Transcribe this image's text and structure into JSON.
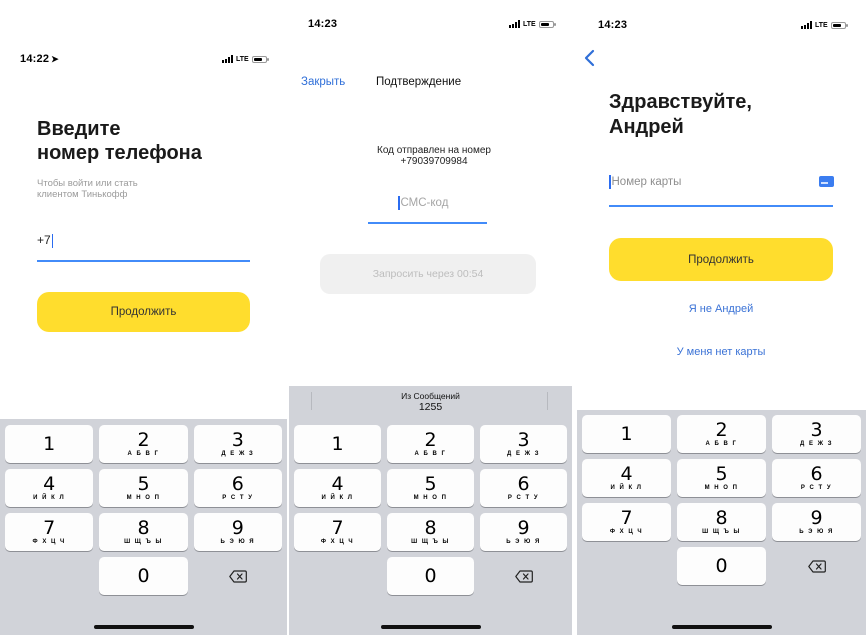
{
  "screen1": {
    "status": {
      "time": "14:22",
      "network": "LTE",
      "location_icon": "location-arrow-icon"
    },
    "title": [
      "Введите",
      "номер телефона"
    ],
    "subtitle": [
      "Чтобы войти или стать",
      "клиентом Тинькофф"
    ],
    "phone_value": "+7",
    "continue_label": "Продолжить"
  },
  "screen2": {
    "status": {
      "time": "14:23",
      "network": "LTE"
    },
    "close_label": "Закрыть",
    "nav_title": "Подтверждение",
    "code_sent": [
      "Код отправлен на номер",
      "+79039709984"
    ],
    "sms_placeholder": "СМС-код",
    "resend_label": "Запросить через 00:54",
    "suggestion": {
      "source": "Из Сообщений",
      "code": "1255"
    }
  },
  "screen3": {
    "status": {
      "time": "14:23",
      "network": "LTE"
    },
    "greeting": [
      "Здравствуйте,",
      "Андрей"
    ],
    "card_placeholder": "Номер карты",
    "continue_label": "Продолжить",
    "not_me_label": "Я не Андрей",
    "no_card_label": "У меня нет карты"
  },
  "keypad": [
    {
      "digit": "1",
      "letters": ""
    },
    {
      "digit": "2",
      "letters": "А Б В Г"
    },
    {
      "digit": "3",
      "letters": "Д Е Ж З"
    },
    {
      "digit": "4",
      "letters": "И Й К Л"
    },
    {
      "digit": "5",
      "letters": "М Н О П"
    },
    {
      "digit": "6",
      "letters": "Р С Т У"
    },
    {
      "digit": "7",
      "letters": "Ф Х Ц Ч"
    },
    {
      "digit": "8",
      "letters": "Ш Щ Ъ Ы"
    },
    {
      "digit": "9",
      "letters": "Ь Э Ю Я"
    },
    {
      "digit": "0",
      "letters": ""
    }
  ],
  "colors": {
    "accent_yellow": "#ffdd2d",
    "link_blue": "#2f6fd8",
    "keyboard_bg": "#d1d3d9"
  }
}
